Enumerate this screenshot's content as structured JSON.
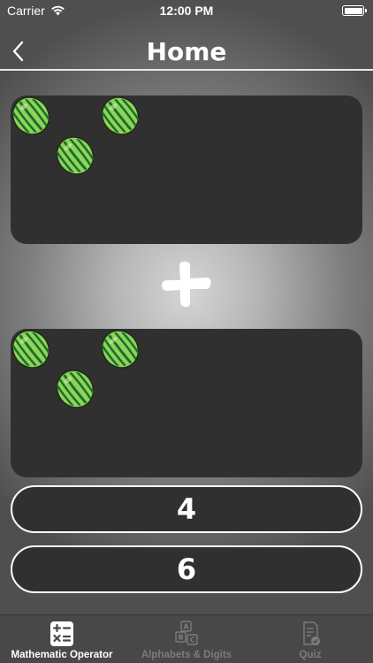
{
  "status_bar": {
    "carrier": "Carrier",
    "time": "12:00 PM"
  },
  "nav": {
    "title": "Home",
    "back_icon": "chevron-left-icon"
  },
  "problem": {
    "operator": "plus",
    "top_group": {
      "fruit": "watermelon-icon",
      "count": 3
    },
    "bottom_group": {
      "fruit": "watermelon-icon",
      "count": 3
    }
  },
  "answers": [
    {
      "label": "4"
    },
    {
      "label": "6"
    }
  ],
  "tab_bar": {
    "active_color": "#ffffff",
    "inactive_color": "#7c7c7c",
    "tabs": [
      {
        "label": "Mathematic Operator",
        "icon": "calculator-icon",
        "active": true
      },
      {
        "label": "Alphabets & Digits",
        "icon": "abc-blocks-icon",
        "active": false
      },
      {
        "label": "Quiz",
        "icon": "quiz-document-icon",
        "active": false
      }
    ]
  }
}
